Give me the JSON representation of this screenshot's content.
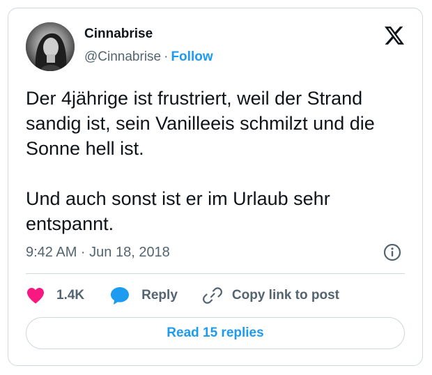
{
  "author": {
    "display_name": "Cinnabrise",
    "handle": "@Cinnabrise",
    "separator": "·",
    "follow_label": "Follow",
    "avatar_icon": "profile-photo"
  },
  "brand": {
    "logo_icon": "x-logo-icon"
  },
  "tweet": {
    "text": "Der 4jährige ist frustriert, weil der Strand sandig ist, sein Vanilleeis schmilzt und die Sonne hell ist.\n\nUnd auch sonst ist er im Urlaub sehr entspannt.",
    "timestamp": "9:42 AM · Jun 18, 2018"
  },
  "actions": {
    "like_count": "1.4K",
    "reply_label": "Reply",
    "copy_label": "Copy link to post"
  },
  "footer": {
    "read_replies_label": "Read 15 replies"
  },
  "colors": {
    "accent": "#1d9bf0",
    "like": "#f91880",
    "text_primary": "#0f1419",
    "text_secondary": "#536471",
    "border": "#cfd9de"
  }
}
